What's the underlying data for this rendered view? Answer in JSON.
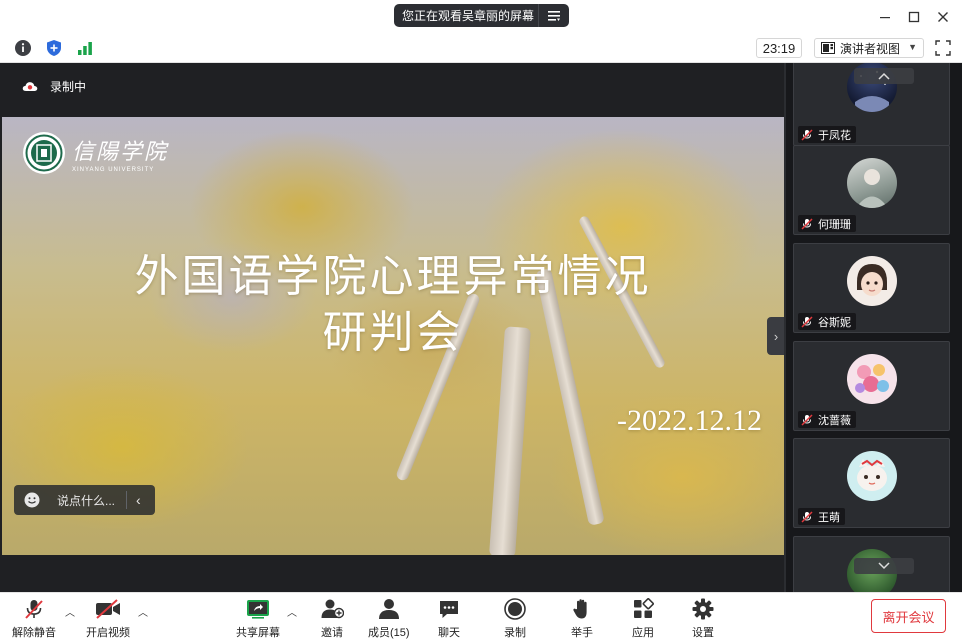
{
  "window": {
    "share_banner": "您正在观看吴章丽的屏幕"
  },
  "infobar": {
    "timer": "23:19",
    "view_mode": "演讲者视图"
  },
  "share": {
    "recording_label": "录制中",
    "slide": {
      "logo_name": "信陽学院",
      "logo_en": "XINYANG UNIVERSITY",
      "title_line1": "外国语学院心理异常情况",
      "title_line2": "研判会",
      "date": "-2022.12.12"
    },
    "chat_placeholder": "说点什么..."
  },
  "gallery": {
    "participants": [
      {
        "name": "于凤花",
        "avatar": "night-sky-avatar"
      },
      {
        "name": "何珊珊",
        "avatar": "portrait-avatar"
      },
      {
        "name": "谷斯妮",
        "avatar": "child-photo-avatar"
      },
      {
        "name": "沈蔷薇",
        "avatar": "flowers-avatar"
      },
      {
        "name": "王萌",
        "avatar": "cartoon-cat-avatar"
      },
      {
        "name": "",
        "avatar": "green-plant-avatar"
      }
    ]
  },
  "toolbar": {
    "unmute": "解除静音",
    "start_video": "开启视频",
    "share_screen": "共享屏幕",
    "invite": "邀请",
    "members": "成员(15)",
    "chat": "聊天",
    "record": "录制",
    "raise_hand": "举手",
    "apps": "应用",
    "settings": "设置",
    "leave": "离开会议"
  },
  "colors": {
    "accent_red": "#e0393e",
    "dark_bg": "#1f2023",
    "share_green": "#1aa34a"
  }
}
